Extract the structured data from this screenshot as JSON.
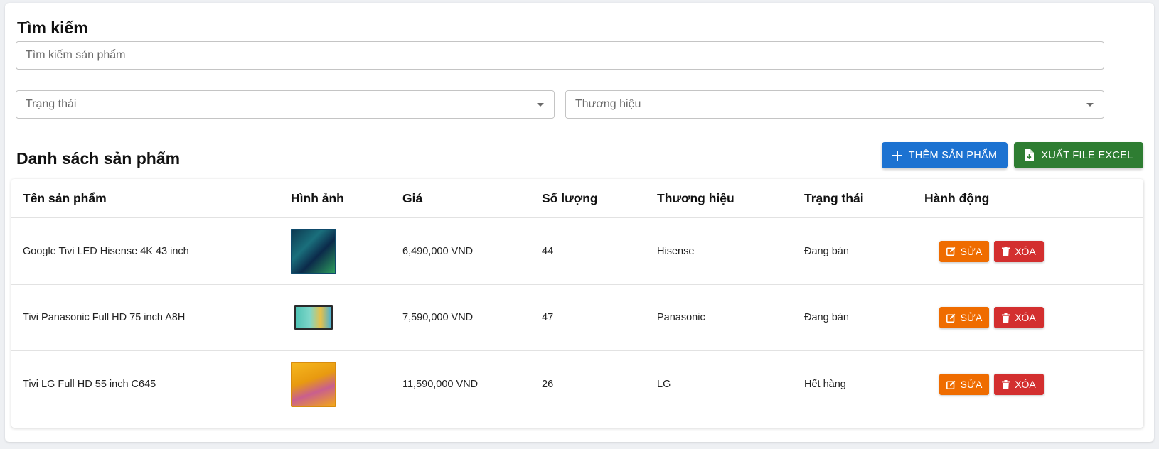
{
  "search": {
    "title": "Tìm kiếm",
    "placeholder": "Tìm kiếm sản phẩm"
  },
  "filters": {
    "status_placeholder": "Trạng thái",
    "brand_placeholder": "Thương hiệu"
  },
  "list": {
    "title": "Danh sách sản phẩm",
    "add_label": "THÊM SẢN PHẨM",
    "export_label": "XUẤT FILE EXCEL"
  },
  "table": {
    "headers": {
      "name": "Tên sản phẩm",
      "image": "Hình ảnh",
      "price": "Giá",
      "quantity": "Số lượng",
      "brand": "Thương hiệu",
      "status": "Trạng thái",
      "actions": "Hành động"
    },
    "rows": [
      {
        "name": "Google Tivi LED Hisense 4K 43 inch",
        "price": "6,490,000 VND",
        "quantity": "44",
        "brand": "Hisense",
        "status": "Đang bán",
        "edit_label": "SỬA",
        "delete_label": "XÓA"
      },
      {
        "name": "Tivi Panasonic Full HD 75 inch A8H",
        "price": "7,590,000 VND",
        "quantity": "47",
        "brand": "Panasonic",
        "status": "Đang bán",
        "edit_label": "SỬA",
        "delete_label": "XÓA"
      },
      {
        "name": "Tivi LG Full HD 55 inch C645",
        "price": "11,590,000 VND",
        "quantity": "26",
        "brand": "LG",
        "status": "Hết hàng",
        "edit_label": "SỬA",
        "delete_label": "XÓA"
      }
    ]
  },
  "colors": {
    "primary": "#1c72d1",
    "success": "#2e7d32",
    "edit": "#ef6c00",
    "delete": "#d32f2f"
  },
  "icons": {
    "add": "plus-icon",
    "export": "file-download-icon",
    "edit": "edit-icon",
    "delete": "trash-icon",
    "select": "caret-down-icon"
  }
}
